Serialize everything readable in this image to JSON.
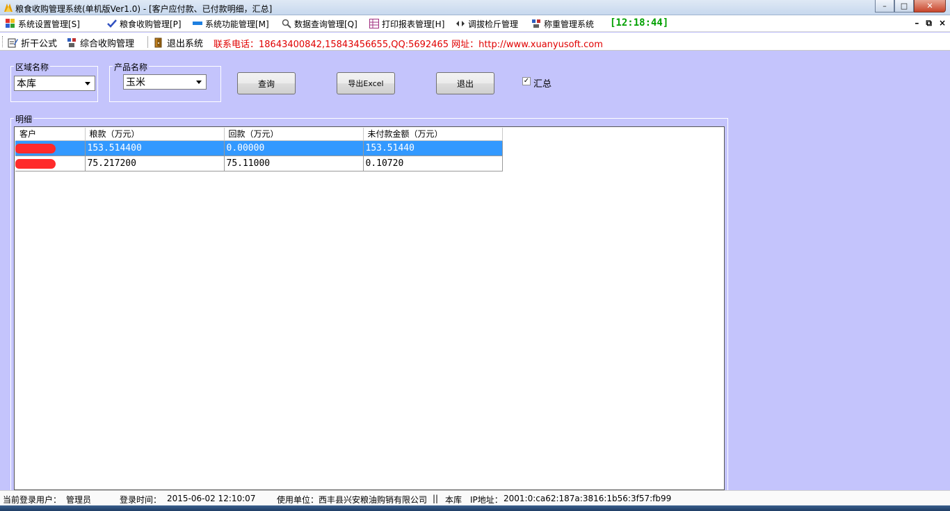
{
  "window": {
    "title": "粮食收购管理系统(单机版Ver1.0) - [客户应付款、已付款明细，汇总]",
    "controls": {
      "minimize": "–",
      "maximize": "□",
      "close": "✕"
    }
  },
  "menu": {
    "items": [
      {
        "label": "系统设置管理[S]",
        "icon": "users-icon"
      },
      {
        "label": "粮食收购管理[P]",
        "icon": "check-icon"
      },
      {
        "label": "系统功能管理[M]",
        "icon": "bar-icon"
      },
      {
        "label": "数据查询管理[Q]",
        "icon": "magnifier-icon"
      },
      {
        "label": "打印报表管理[H]",
        "icon": "grid-icon"
      },
      {
        "label": "调拔检斤管理",
        "icon": "arrows-icon"
      },
      {
        "label": "称重管理系统",
        "icon": "scale-icon"
      }
    ],
    "clock": "[12:18:44]",
    "mdi": {
      "minimize": "–",
      "restore": "⧉",
      "close": "×"
    }
  },
  "toolbar": {
    "items": [
      {
        "label": "折干公式",
        "icon": "edit-icon"
      },
      {
        "label": "综合收购管理",
        "icon": "scale-icon"
      },
      {
        "label": "退出系统",
        "icon": "exit-icon"
      }
    ],
    "contact": "联系电话：18643400842,15843456655,QQ:5692465 网址：http://www.xuanyusoft.com"
  },
  "filters": {
    "region_label": "区域名称",
    "region_value": "本库",
    "product_label": "产品名称",
    "product_value": "玉米",
    "query_button": "查询",
    "export_button": "导出Excel",
    "exit_button": "退出",
    "summary_checkbox": {
      "label": "汇总",
      "checked": true
    }
  },
  "detail": {
    "title": "明细",
    "columns": [
      "客户",
      "粮款（万元）",
      "回款（万元）",
      "未付款金额（万元）"
    ],
    "rows": [
      {
        "customer": "",
        "grain_payment": "153.514400",
        "repayment": "0.00000",
        "unpaid": "153.51440",
        "selected": true
      },
      {
        "customer": "",
        "grain_payment": "75.217200",
        "repayment": "75.11000",
        "unpaid": "0.10720",
        "selected": false
      }
    ]
  },
  "status": {
    "user_label": "当前登录用户：",
    "user": "管理员",
    "login_label": "登录时间：",
    "login_time": "2015-06-02 12:10:07",
    "unit_label": "使用单位：",
    "unit": "西丰县兴安粮油购销有限公司",
    "separator": "||",
    "location": "本库",
    "ip_label": "IP地址：",
    "ip": "2001:0:ca62:187a:3816:1b56:3f57:fb99"
  },
  "colors": {
    "background": "#c4c4fc",
    "selection": "#3399ff",
    "clock": "#00a000",
    "contact": "#e00000",
    "redaction": "#ff2b2b"
  }
}
